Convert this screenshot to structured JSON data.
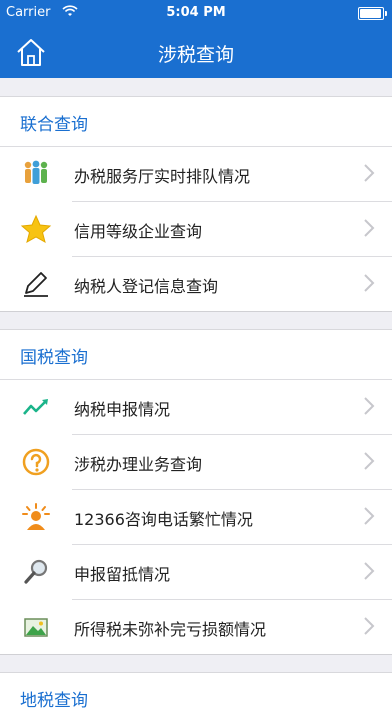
{
  "status": {
    "carrier": "Carrier",
    "time": "5:04 PM"
  },
  "nav": {
    "title": "涉税查询"
  },
  "sections": [
    {
      "title": "联合查询",
      "items": [
        {
          "label": "办税服务厅实时排队情况",
          "icon": "people-queue-icon"
        },
        {
          "label": "信用等级企业查询",
          "icon": "star-icon"
        },
        {
          "label": "纳税人登记信息查询",
          "icon": "pen-icon"
        }
      ]
    },
    {
      "title": "国税查询",
      "items": [
        {
          "label": "纳税申报情况",
          "icon": "trend-line-icon"
        },
        {
          "label": "涉税办理业务查询",
          "icon": "question-icon"
        },
        {
          "label": "12366咨询电话繁忙情况",
          "icon": "call-operator-icon"
        },
        {
          "label": "申报留抵情况",
          "icon": "magnifier-icon"
        },
        {
          "label": "所得税未弥补完亏损额情况",
          "icon": "landscape-image-icon"
        }
      ]
    },
    {
      "title": "地税查询"
    }
  ],
  "colors": {
    "accent": "#1a6fd0",
    "background": "#efeff4"
  }
}
